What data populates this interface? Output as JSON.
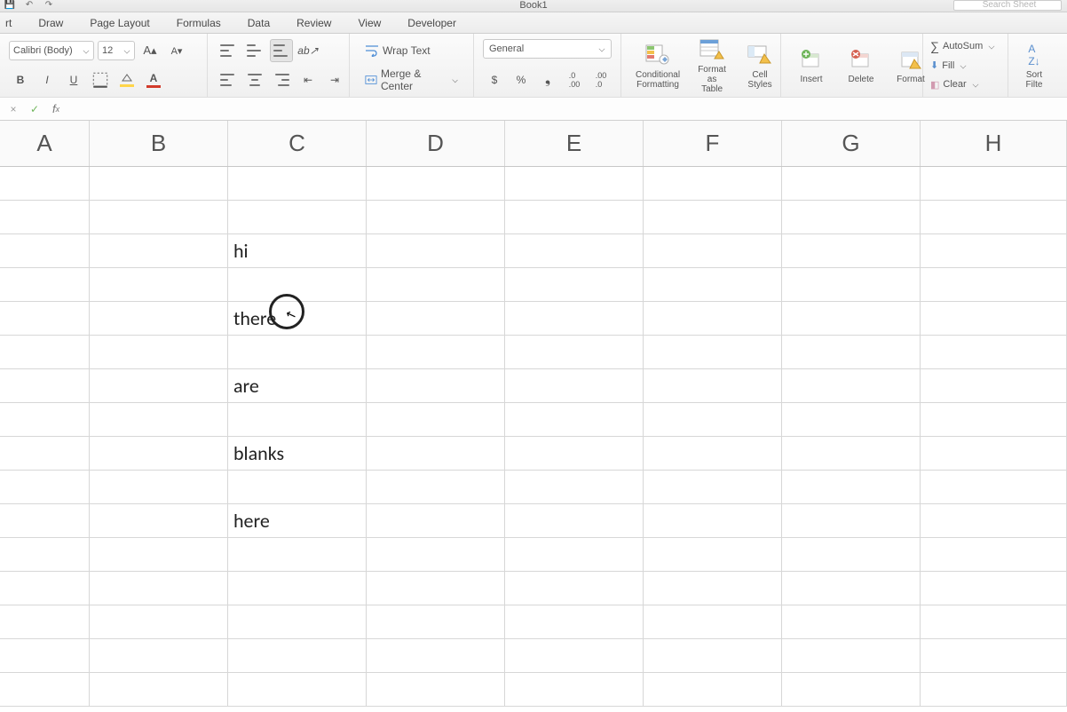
{
  "title": "Book1",
  "search_placeholder": "Search Sheet",
  "tabs": {
    "t0_cut": "rt",
    "draw": "Draw",
    "page_layout": "Page Layout",
    "formulas": "Formulas",
    "data": "Data",
    "review": "Review",
    "view": "View",
    "developer": "Developer"
  },
  "font": {
    "name": "Calibri (Body)",
    "size": "12"
  },
  "align": {
    "wrap": "Wrap Text",
    "merge": "Merge & Center"
  },
  "number_format": "General",
  "styles": {
    "cond": "Conditional\nFormatting",
    "table": "Format\nas Table",
    "cell": "Cell\nStyles"
  },
  "cells_grp": {
    "insert": "Insert",
    "delete": "Delete",
    "format": "Format"
  },
  "editing": {
    "sum": "AutoSum",
    "fill": "Fill",
    "clear": "Clear",
    "sort": "Sort\nFilte"
  },
  "cols": [
    "A",
    "B",
    "C",
    "D",
    "E",
    "F",
    "G",
    "H"
  ],
  "data_rows": {
    "3": {
      "C": "hi"
    },
    "5": {
      "C": "there"
    },
    "7": {
      "C": "are"
    },
    "9": {
      "C": "blanks"
    },
    "11": {
      "C": "here"
    }
  }
}
